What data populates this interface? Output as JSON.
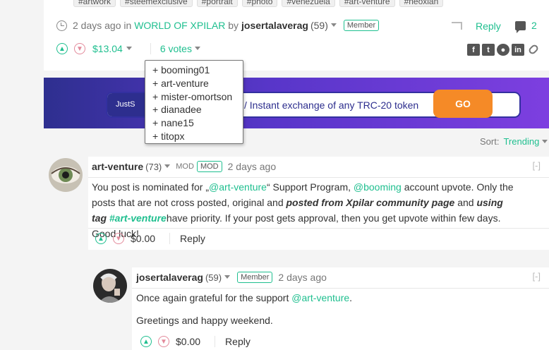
{
  "post": {
    "tags": [
      "#artwork",
      "#steemexclusive",
      "#portrait",
      "#photo",
      "#venezuela",
      "#art-venture",
      "#neoxian"
    ],
    "time": "2 days ago",
    "in": "in",
    "community": "WORLD OF XPILAR",
    "by": "by",
    "author": "josertalaverag",
    "rep": "(59)",
    "badge": "Member",
    "reply": "Reply",
    "comment_count": "2",
    "payout": "$13.04",
    "votes": "6 votes"
  },
  "voters": [
    "+ booming01",
    "+ art-venture",
    "+ mister-omortson",
    "+ dianadee",
    "+ nane15",
    "+ titopx"
  ],
  "banner": {
    "brand": "JustS",
    "text": "/ Instant exchange of any TRC-20 token",
    "button": "GO"
  },
  "sort": {
    "label": "Sort:",
    "value": "Trending"
  },
  "comments": [
    {
      "author": "art-venture",
      "rep": "(73)",
      "mod_label": "MOD",
      "badge": "MOD",
      "time": "2 days ago",
      "collapse": "[-]",
      "body_1": "You post is nominated for „",
      "mention_1": "@art-venture",
      "body_2": "“ Support Program, ",
      "mention_2": "@booming",
      "body_3": " account upvote. Only the posts that are not cross posted, original and ",
      "bold_1": "posted from Xpilar community page",
      "body_4": " and ",
      "bold_2": "using tag ",
      "tag": "#art-venture",
      "body_5": "have priority. If your post gets approval, then you get upvote within few days. Good luck!",
      "payout": "$0.00",
      "reply": "Reply"
    },
    {
      "author": "josertalaverag",
      "rep": "(59)",
      "badge": "Member",
      "time": "2 days ago",
      "collapse": "[-]",
      "line1_a": "Once again grateful for the support ",
      "line1_mention": "@art-venture",
      "line1_b": ".",
      "line2": "Greetings and happy weekend.",
      "payout": "$0.00",
      "reply": "Reply"
    }
  ]
}
